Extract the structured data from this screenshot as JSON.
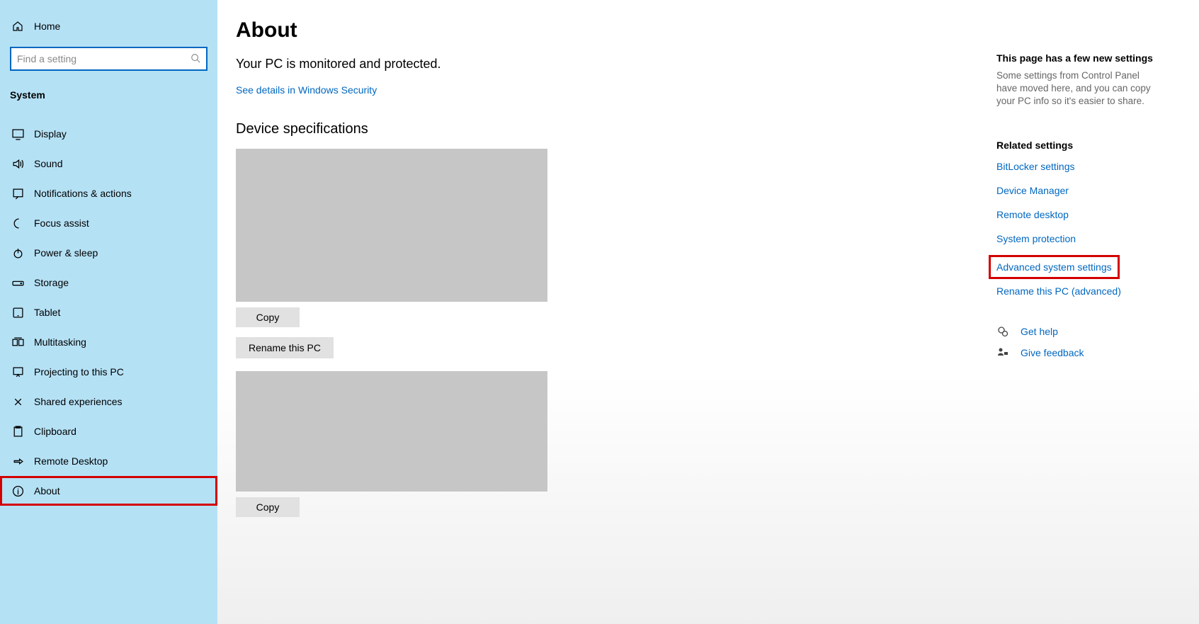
{
  "sidebar": {
    "home": "Home",
    "search_placeholder": "Find a setting",
    "section": "System",
    "items": [
      {
        "icon": "display",
        "label": "Display"
      },
      {
        "icon": "sound",
        "label": "Sound"
      },
      {
        "icon": "notifications",
        "label": "Notifications & actions"
      },
      {
        "icon": "focus",
        "label": "Focus assist"
      },
      {
        "icon": "power",
        "label": "Power & sleep"
      },
      {
        "icon": "storage",
        "label": "Storage"
      },
      {
        "icon": "tablet",
        "label": "Tablet"
      },
      {
        "icon": "multitasking",
        "label": "Multitasking"
      },
      {
        "icon": "projecting",
        "label": "Projecting to this PC"
      },
      {
        "icon": "shared",
        "label": "Shared experiences"
      },
      {
        "icon": "clipboard",
        "label": "Clipboard"
      },
      {
        "icon": "remote",
        "label": "Remote Desktop"
      },
      {
        "icon": "about",
        "label": "About"
      }
    ]
  },
  "main": {
    "title": "About",
    "status": "Your PC is monitored and protected.",
    "security_link": "See details in Windows Security",
    "device_spec_header": "Device specifications",
    "copy_label": "Copy",
    "rename_label": "Rename this PC"
  },
  "right": {
    "new_settings_title": "This page has a few new settings",
    "new_settings_desc": "Some settings from Control Panel have moved here, and you can copy your PC info so it's easier to share.",
    "related_title": "Related settings",
    "links": [
      "BitLocker settings",
      "Device Manager",
      "Remote desktop",
      "System protection",
      "Advanced system settings",
      "Rename this PC (advanced)"
    ],
    "get_help": "Get help",
    "give_feedback": "Give feedback"
  }
}
